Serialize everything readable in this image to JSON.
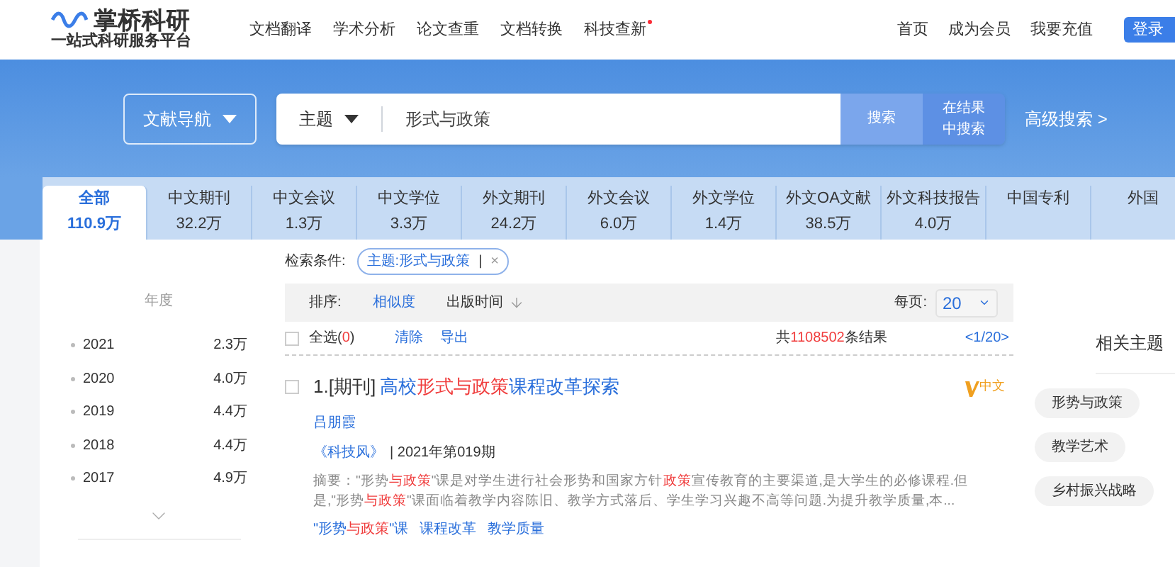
{
  "logo": {
    "name": "掌桥科研",
    "slogan": "一站式科研服务平台"
  },
  "nav": [
    {
      "label": "文档翻译",
      "dot": false
    },
    {
      "label": "学术分析",
      "dot": false
    },
    {
      "label": "论文查重",
      "dot": false
    },
    {
      "label": "文档转换",
      "dot": false
    },
    {
      "label": "科技查新",
      "dot": true
    }
  ],
  "user_nav": [
    "首页",
    "成为会员",
    "我要充值"
  ],
  "login": "登录",
  "search": {
    "nav_button": "文献导航",
    "field_type": "主题",
    "value": "形式与政策",
    "search_button": "搜索",
    "within_button_lines": [
      "在结果",
      "中搜索"
    ],
    "advanced": "高级搜索 >"
  },
  "tabs": [
    {
      "label": "全部",
      "count": "110.9万",
      "selected": true
    },
    {
      "label": "中文期刊",
      "count": "32.2万",
      "selected": false
    },
    {
      "label": "中文会议",
      "count": "1.3万",
      "selected": false
    },
    {
      "label": "中文学位",
      "count": "3.3万",
      "selected": false
    },
    {
      "label": "外文期刊",
      "count": "24.2万",
      "selected": false
    },
    {
      "label": "外文会议",
      "count": "6.0万",
      "selected": false
    },
    {
      "label": "外文学位",
      "count": "1.4万",
      "selected": false
    },
    {
      "label": "外文OA文献",
      "count": "38.5万",
      "selected": false
    },
    {
      "label": "外文科技报告",
      "count": "4.0万",
      "selected": false
    },
    {
      "label": "中国专利",
      "selected": false
    },
    {
      "label": "外国",
      "selected": false
    }
  ],
  "sidebar": {
    "title": "年度",
    "items": [
      {
        "year": "2021",
        "count": "2.3万"
      },
      {
        "year": "2020",
        "count": "4.0万"
      },
      {
        "year": "2019",
        "count": "4.4万"
      },
      {
        "year": "2018",
        "count": "4.4万"
      },
      {
        "year": "2017",
        "count": "4.9万"
      }
    ]
  },
  "conditions": {
    "label": "检索条件:",
    "chip": "主题:形式与政策",
    "separator": "|",
    "remove": "×"
  },
  "sort": {
    "label": "排序:",
    "options": [
      {
        "label": "相似度",
        "selected": true
      },
      {
        "label": "出版时间",
        "selected": false
      }
    ],
    "per_page_label": "每页:",
    "per_page": "20"
  },
  "select_bar": {
    "select_all": "全选",
    "count_open": "(",
    "count": "0",
    "count_close": ")",
    "checked": false,
    "clear": "清除",
    "export": "导出",
    "total_prefix": "共",
    "total": "1108502",
    "total_suffix": "条结果",
    "pager": "<1/20>"
  },
  "results": [
    {
      "index": "1.[期刊]",
      "checked": false,
      "title": [
        {
          "text": "高校",
          "hit": false
        },
        {
          "text": "形式与政策",
          "hit": true
        },
        {
          "text": "课程改革探索",
          "hit": false
        }
      ],
      "lang": "中文",
      "author": "吕朋霞",
      "journal": "《科技风》",
      "issue": "| 2021年第019期",
      "abstract": [
        {
          "text": "摘要：\"形势",
          "hit": false
        },
        {
          "text": "与政策",
          "hit": true
        },
        {
          "text": "\"课是对学生进行社会形势和国家方针",
          "hit": false
        },
        {
          "text": "政策",
          "hit": true
        },
        {
          "text": "宣传教育的主要渠道,是大学生的必修课程.但是,\"形势",
          "hit": false
        },
        {
          "text": "与政策",
          "hit": true
        },
        {
          "text": "\"课面临着教学内容陈旧、教学方式落后、学生学习兴趣不高等问题.为提升教学质量,本...",
          "hit": false
        }
      ],
      "keywords": [
        [
          {
            "text": "\"形势",
            "hit": false
          },
          {
            "text": "与政策",
            "hit": true
          },
          {
            "text": "\"课",
            "hit": false
          }
        ],
        [
          {
            "text": "课程改革",
            "hit": false
          }
        ],
        [
          {
            "text": "教学质量",
            "hit": false
          }
        ]
      ]
    }
  ],
  "related": {
    "title": "相关主题",
    "topics": [
      "形势与政策",
      "教学艺术",
      "乡村振兴战略"
    ]
  }
}
